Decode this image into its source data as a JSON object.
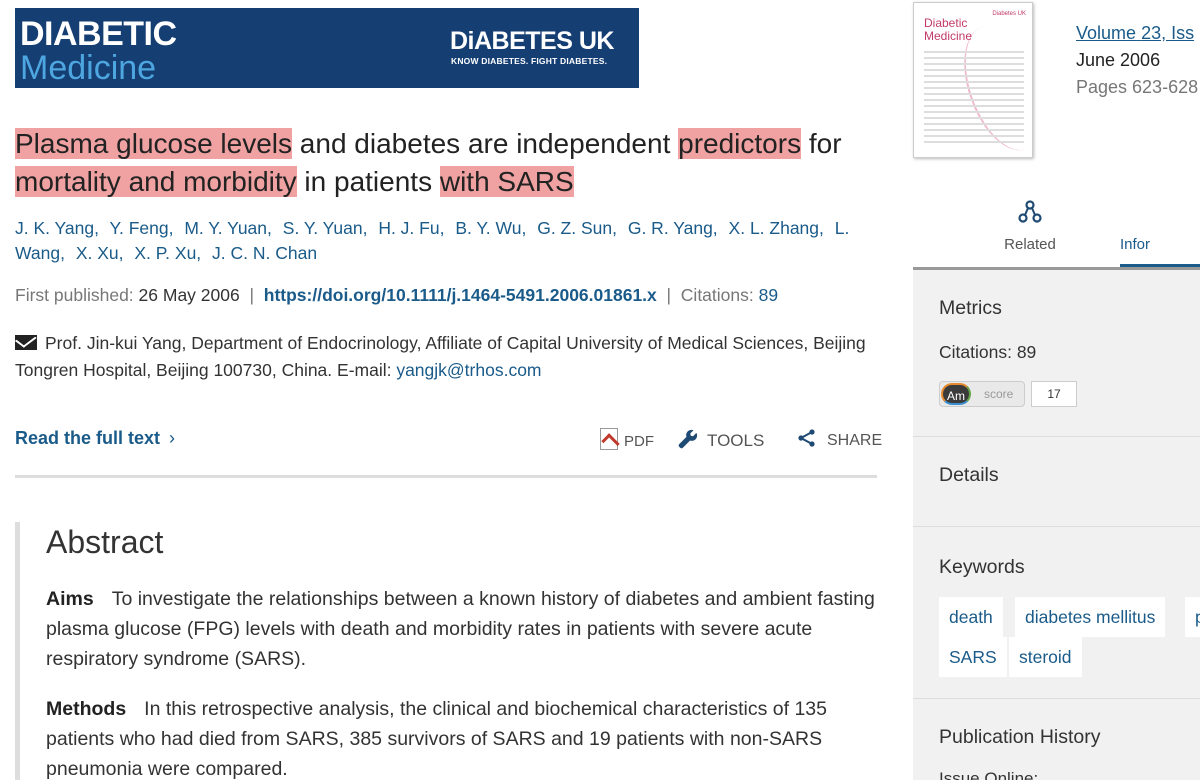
{
  "banner": {
    "journal_line1": "DIABETIC",
    "journal_line2": "Medicine",
    "org_name": "DiABETES UK",
    "org_tagline": "KNOW DIABETES. FIGHT DIABETES."
  },
  "cover": {
    "title_line1": "Diabetic",
    "title_line2": "Medicine",
    "corner": "Diabetes UK"
  },
  "issue": {
    "volume_label": "Volume",
    "volume_number": "23, Iss",
    "date": "June 2006",
    "pages": "Pages 623-628"
  },
  "article": {
    "title_part1": "Plasma glucose levels",
    "title_part2": " and diabetes are independent ",
    "title_part3": "predictors",
    "title_part4": " for ",
    "title_part5": "mortality and morbidity",
    "title_part6": " in patients ",
    "title_part7": "with SARS",
    "authors": [
      "J. K. Yang,",
      "Y. Feng,",
      "M. Y. Yuan,",
      "S. Y. Yuan,",
      "H. J. Fu,",
      "B. Y. Wu,",
      "G. Z. Sun,",
      "G. R. Yang,",
      "X. L. Zhang,",
      "L. Wang,",
      "X. Xu,",
      "X. P. Xu,",
      "J. C. N. Chan"
    ],
    "first_published_label": "First published:",
    "first_published_date": "26 May 2006",
    "doi": "https://doi.org/10.1111/j.1464-5491.2006.01861.x",
    "citations_label": "Citations:",
    "citations_count": "89",
    "correspondence": "Prof. Jin-kui Yang, Department of Endocrinology, Affiliate of Capital University of Medical Sciences, Beijing Tongren Hospital, Beijing 100730, China. E-mail: ",
    "email": "yangjk@trhos.com"
  },
  "actions": {
    "read_full": "Read the full text",
    "pdf": "PDF",
    "tools": "TOOLS",
    "share": "SHARE"
  },
  "abstract": {
    "heading": "Abstract",
    "aims_label": "Aims",
    "aims_text": "To investigate the relationships between a known history of diabetes and ambient fasting plasma glucose (FPG) levels with death and morbidity rates in patients with severe acute respiratory syndrome (SARS).",
    "methods_label": "Methods",
    "methods_text": "In this retrospective analysis, the clinical and biochemical characteristics of 135 patients who had died from SARS, 385 survivors of SARS and 19 patients with non-SARS pneumonia were compared."
  },
  "sidebar": {
    "tab_related": "Related",
    "tab_info": "Infor",
    "metrics_heading": "Metrics",
    "citations_label": "Citations:",
    "citations_count": "89",
    "altmetric_am": "Am",
    "altmetric_score": "score",
    "altmetric_value": "17",
    "details_heading": "Details",
    "keywords_heading": "Keywords",
    "keywords": [
      "death",
      "diabetes mellitus",
      "p",
      "SARS",
      "steroid"
    ],
    "pubhist_heading": "Publication History",
    "pubhist_sub": "Issue Online:"
  },
  "colors": {
    "brand_navy": "#153e73",
    "link": "#1a5b8a",
    "highlight": "#f0a2a2",
    "panel_bg": "#f1f1f1"
  }
}
